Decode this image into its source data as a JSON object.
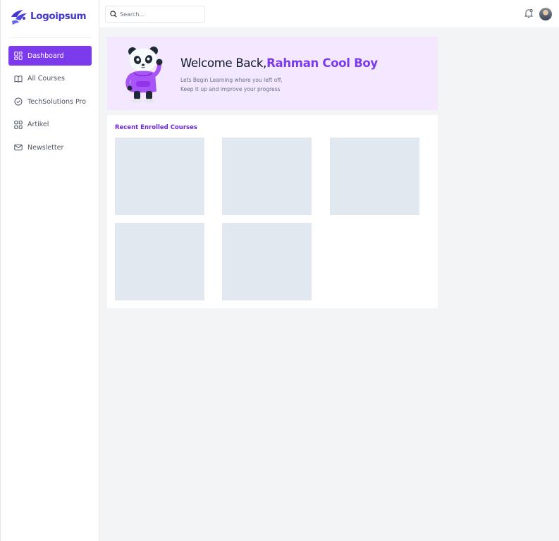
{
  "brand": {
    "name": "Logoipsum",
    "color": "#4338ca"
  },
  "accent": "#7c3aed",
  "sidebar": {
    "items": [
      {
        "label": "Dashboard",
        "icon": "dashboard-grid-icon",
        "active": true
      },
      {
        "label": "All Courses",
        "icon": "book-open-icon",
        "active": false
      },
      {
        "label": "TechSolutions Pro",
        "icon": "check-circle-icon",
        "active": false
      },
      {
        "label": "Artikel",
        "icon": "grid-icon",
        "active": false
      },
      {
        "label": "Newsletter",
        "icon": "mail-icon",
        "active": false
      }
    ]
  },
  "header": {
    "search_placeholder": "Search...",
    "notification_icon": "bell-icon",
    "avatar_icon": "user-avatar"
  },
  "banner": {
    "greeting": "Welcome Back,",
    "user_name": "Rahman Cool Boy",
    "line1": "Lets Begin Learning where you left off,",
    "line2": "Keep it up and improve your progress",
    "background": "#f3e8ff"
  },
  "courses": {
    "title": "Recent Enrolled Courses",
    "placeholder_color": "#e2e8f0",
    "count": 5
  }
}
